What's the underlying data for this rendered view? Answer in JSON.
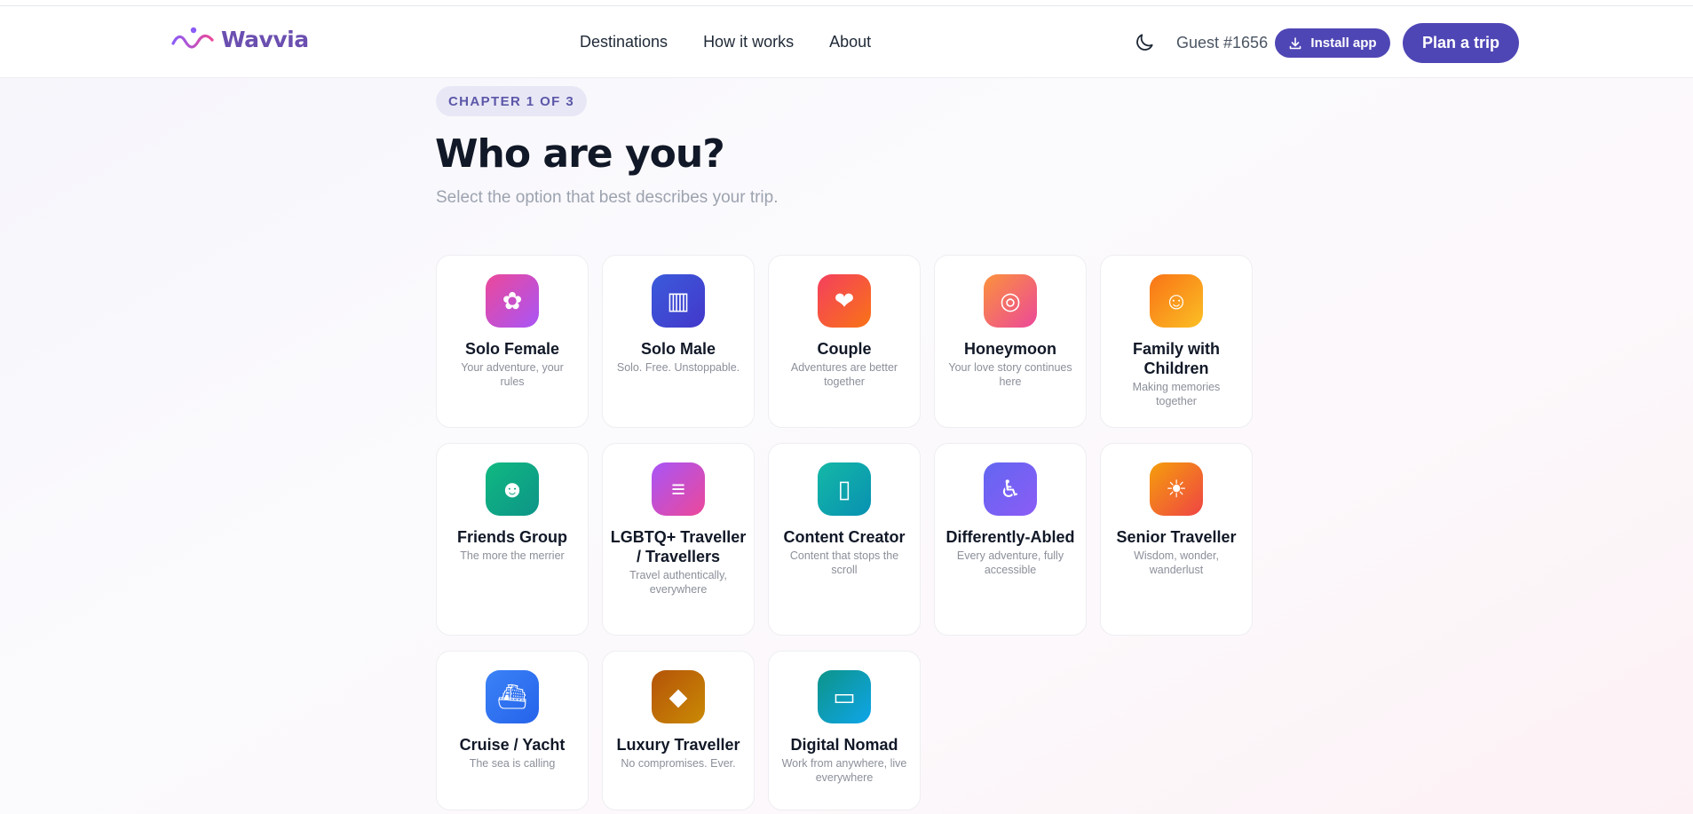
{
  "brand": {
    "name": "Wavvia",
    "accent": "#4f46b5",
    "logo_color": "#6b4fb0"
  },
  "nav": {
    "items": [
      "Destinations",
      "How it works",
      "About"
    ]
  },
  "header": {
    "theme_icon": "moon-icon",
    "guest_label": "Guest #1656",
    "install_label": "Install app",
    "install_icon": "download-icon",
    "plan_label": "Plan a trip"
  },
  "page": {
    "chapter": "CHAPTER 1 OF 3",
    "title": "Who are you?",
    "subtitle": "Select the option that best describes your trip."
  },
  "options": [
    {
      "title": "Solo Female",
      "desc": "Your adventure, your rules",
      "icon": "hibiscus-icon",
      "glyph": "✿",
      "gradient": [
        "#ec4899",
        "#a855f7"
      ]
    },
    {
      "title": "Solo Male",
      "desc": "Solo. Free. Unstoppable.",
      "icon": "luggage-icon",
      "glyph": "▥",
      "gradient": [
        "#3b5bdb",
        "#4338ca"
      ]
    },
    {
      "title": "Couple",
      "desc": "Adventures are better together",
      "icon": "couple-heart-icon",
      "glyph": "❤",
      "gradient": [
        "#f43f5e",
        "#f97316"
      ]
    },
    {
      "title": "Honeymoon",
      "desc": "Your love story continues here",
      "icon": "ring-icon",
      "glyph": "◎",
      "gradient": [
        "#fb923c",
        "#ec4899"
      ]
    },
    {
      "title": "Family with Children",
      "desc": "Making memories together",
      "icon": "family-icon",
      "glyph": "☺",
      "gradient": [
        "#f97316",
        "#fbbf24"
      ]
    },
    {
      "title": "Friends Group",
      "desc": "The more the merrier",
      "icon": "party-face-icon",
      "glyph": "☻",
      "gradient": [
        "#10b981",
        "#0d9488"
      ]
    },
    {
      "title": "LGBTQ+ Traveller / Travellers",
      "desc": "Travel authentically, everywhere",
      "icon": "rainbow-flag-icon",
      "glyph": "≡",
      "gradient": [
        "#a855f7",
        "#ec4899"
      ]
    },
    {
      "title": "Content Creator",
      "desc": "Content that stops the scroll",
      "icon": "phone-icon",
      "glyph": "▯",
      "gradient": [
        "#14b8a6",
        "#0891b2"
      ]
    },
    {
      "title": "Differently-Abled",
      "desc": "Every adventure, fully accessible",
      "icon": "wheelchair-icon",
      "glyph": "♿",
      "gradient": [
        "#6366f1",
        "#8b5cf6"
      ]
    },
    {
      "title": "Senior Traveller",
      "desc": "Wisdom, wonder, wanderlust",
      "icon": "sunrise-icon",
      "glyph": "☀",
      "gradient": [
        "#f59e0b",
        "#ef4444"
      ]
    },
    {
      "title": "Cruise / Yacht",
      "desc": "The sea is calling",
      "icon": "ship-icon",
      "glyph": "⛴",
      "gradient": [
        "#3b82f6",
        "#2563eb"
      ]
    },
    {
      "title": "Luxury Traveller",
      "desc": "No compromises. Ever.",
      "icon": "gem-icon",
      "glyph": "◆",
      "gradient": [
        "#b45309",
        "#ca8a04"
      ]
    },
    {
      "title": "Digital Nomad",
      "desc": "Work from anywhere, live everywhere",
      "icon": "laptop-icon",
      "glyph": "▭",
      "gradient": [
        "#0d9488",
        "#0ea5e9"
      ]
    }
  ]
}
